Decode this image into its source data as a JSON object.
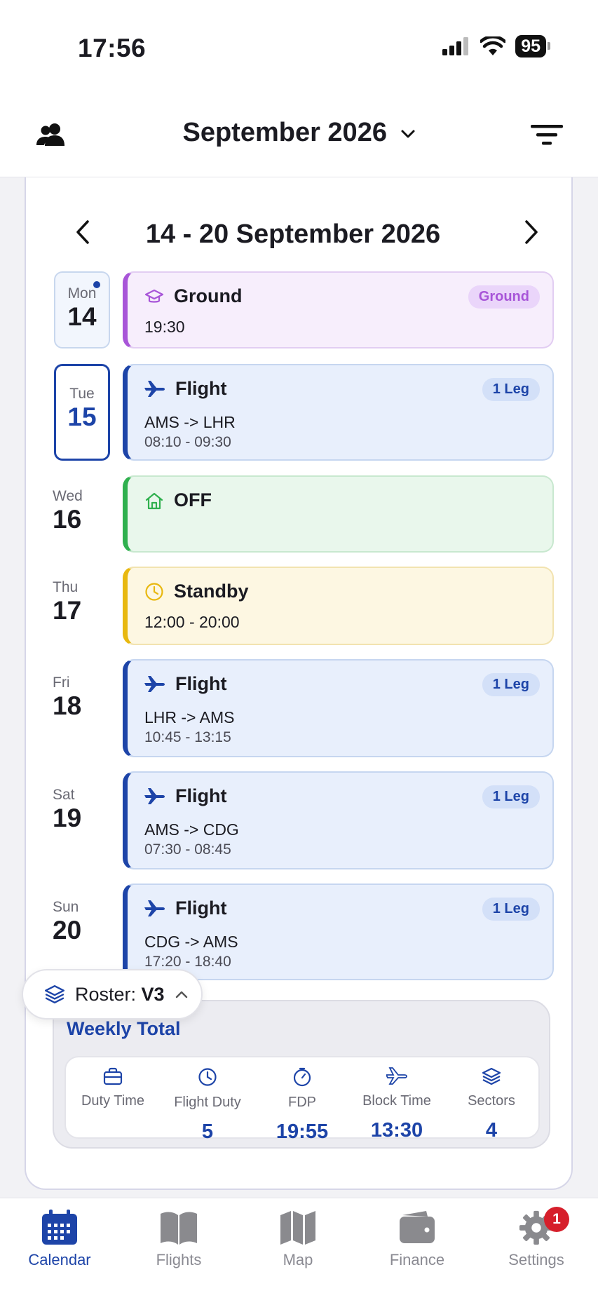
{
  "status": {
    "time": "17:56",
    "battery": "95"
  },
  "header": {
    "month": "September 2026"
  },
  "week": {
    "title": "14 - 20 September 2026"
  },
  "days": [
    {
      "dow": "Mon",
      "num": "14",
      "event": {
        "type": "ground",
        "title": "Ground",
        "badge": "Ground",
        "line2": "19:30"
      }
    },
    {
      "dow": "Tue",
      "num": "15",
      "event": {
        "type": "flight",
        "title": "Flight",
        "badge": "1 Leg",
        "route": "AMS -> LHR",
        "times": "08:10 - 09:30"
      }
    },
    {
      "dow": "Wed",
      "num": "16",
      "event": {
        "type": "off",
        "title": "OFF"
      }
    },
    {
      "dow": "Thu",
      "num": "17",
      "event": {
        "type": "standby",
        "title": "Standby",
        "line2": "12:00 - 20:00"
      }
    },
    {
      "dow": "Fri",
      "num": "18",
      "event": {
        "type": "flight",
        "title": "Flight",
        "badge": "1 Leg",
        "route": "LHR -> AMS",
        "times": "10:45 - 13:15"
      }
    },
    {
      "dow": "Sat",
      "num": "19",
      "event": {
        "type": "flight",
        "title": "Flight",
        "badge": "1 Leg",
        "route": "AMS -> CDG",
        "times": "07:30 - 08:45"
      }
    },
    {
      "dow": "Sun",
      "num": "20",
      "event": {
        "type": "flight",
        "title": "Flight",
        "badge": "1 Leg",
        "route": "CDG -> AMS",
        "times": "17:20 - 18:40"
      }
    }
  ],
  "weekly": {
    "title": "Weekly Total",
    "stats": [
      {
        "label": "Duty Time",
        "icon": "briefcase-icon",
        "value": ""
      },
      {
        "label": "Flight Duty",
        "icon": "clock-icon",
        "value": "5"
      },
      {
        "label": "FDP",
        "icon": "timer-icon",
        "value": "19:55"
      },
      {
        "label": "Block Time",
        "icon": "plane-icon",
        "value": "13:30"
      },
      {
        "label": "Sectors",
        "icon": "layers-icon",
        "value": "4"
      }
    ]
  },
  "roster": {
    "label": "Roster:",
    "version": "V3"
  },
  "tabs": [
    {
      "label": "Calendar",
      "icon": "calendar-icon",
      "active": true
    },
    {
      "label": "Flights",
      "icon": "book-icon"
    },
    {
      "label": "Map",
      "icon": "map-icon"
    },
    {
      "label": "Finance",
      "icon": "wallet-icon"
    },
    {
      "label": "Settings",
      "icon": "gear-icon",
      "badge": "1"
    }
  ],
  "colors": {
    "primary": "#1d44a8",
    "ground": "#a855d8",
    "off": "#2fb04e",
    "standby": "#e8b80f",
    "notification": "#d61f2b"
  }
}
